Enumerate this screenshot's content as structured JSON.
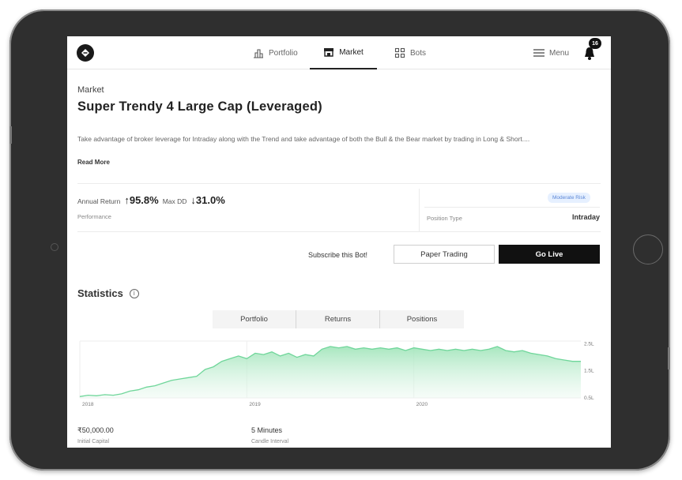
{
  "nav": {
    "items": [
      {
        "label": "Portfolio",
        "icon": "bar-chart-icon",
        "active": false
      },
      {
        "label": "Market",
        "icon": "store-icon",
        "active": true
      },
      {
        "label": "Bots",
        "icon": "grid-icon",
        "active": false
      }
    ],
    "menu_label": "Menu",
    "notification_count": "16"
  },
  "breadcrumb": "Market",
  "title": "Super Trendy 4 Large Cap (Leveraged)",
  "description": "Take advantage of broker leverage for Intraday along with the Trend and take advantage of both the Bull & the Bear market by trading in Long & Short....",
  "read_more": "Read More",
  "performance": {
    "annual_return_label": "Annual Return",
    "annual_return_value": "95.8%",
    "max_dd_label": "Max DD",
    "max_dd_value": "31.0%",
    "sub_label": "Performance"
  },
  "risk_badge": "Moderate Risk",
  "position_type_label": "Position Type",
  "position_type_value": "Intraday",
  "actions": {
    "subscribe_text": "Subscribe this Bot!",
    "paper_trading": "Paper Trading",
    "go_live": "Go Live"
  },
  "statistics": {
    "title": "Statistics",
    "tabs": [
      "Portfolio",
      "Returns",
      "Positions"
    ]
  },
  "chart_data": {
    "type": "area",
    "x_ticks": [
      "2018",
      "2019",
      "2020"
    ],
    "y_ticks": [
      "2.5L",
      "1.5L",
      "0.5L"
    ],
    "ylim": [
      0.5,
      2.6
    ],
    "x": [
      2018.0,
      2018.05,
      2018.1,
      2018.15,
      2018.2,
      2018.25,
      2018.3,
      2018.35,
      2018.4,
      2018.45,
      2018.5,
      2018.55,
      2018.6,
      2018.65,
      2018.7,
      2018.75,
      2018.8,
      2018.85,
      2018.9,
      2018.95,
      2019.0,
      2019.05,
      2019.1,
      2019.15,
      2019.2,
      2019.25,
      2019.3,
      2019.35,
      2019.4,
      2019.45,
      2019.5,
      2019.55,
      2019.6,
      2019.65,
      2019.7,
      2019.75,
      2019.8,
      2019.85,
      2019.9,
      2019.95,
      2020.0,
      2020.05,
      2020.1,
      2020.15,
      2020.2,
      2020.25,
      2020.3,
      2020.35,
      2020.4,
      2020.45,
      2020.5,
      2020.55,
      2020.6,
      2020.65,
      2020.7,
      2020.75,
      2020.8,
      2020.85,
      2020.9,
      2020.95,
      2021.0
    ],
    "y": [
      0.55,
      0.6,
      0.58,
      0.62,
      0.6,
      0.65,
      0.75,
      0.8,
      0.9,
      0.95,
      1.05,
      1.15,
      1.2,
      1.25,
      1.3,
      1.55,
      1.65,
      1.85,
      1.95,
      2.05,
      1.95,
      2.15,
      2.1,
      2.2,
      2.05,
      2.15,
      2.0,
      2.1,
      2.05,
      2.3,
      2.4,
      2.35,
      2.4,
      2.3,
      2.35,
      2.3,
      2.35,
      2.3,
      2.35,
      2.25,
      2.35,
      2.3,
      2.25,
      2.3,
      2.25,
      2.3,
      2.25,
      2.3,
      2.25,
      2.3,
      2.4,
      2.25,
      2.2,
      2.25,
      2.15,
      2.1,
      2.05,
      1.95,
      1.9,
      1.85,
      1.85
    ]
  },
  "footer": {
    "capital_value": "₹50,000.00",
    "capital_label": "Initial Capital",
    "candle_value": "5 Minutes",
    "candle_label": "Candle Interval"
  },
  "colors": {
    "accent": "#111111",
    "chart_line": "#6fd69a",
    "chart_fill": "#b8ecc9",
    "risk_bg": "#e6f0ff",
    "risk_text": "#5b86d6"
  }
}
